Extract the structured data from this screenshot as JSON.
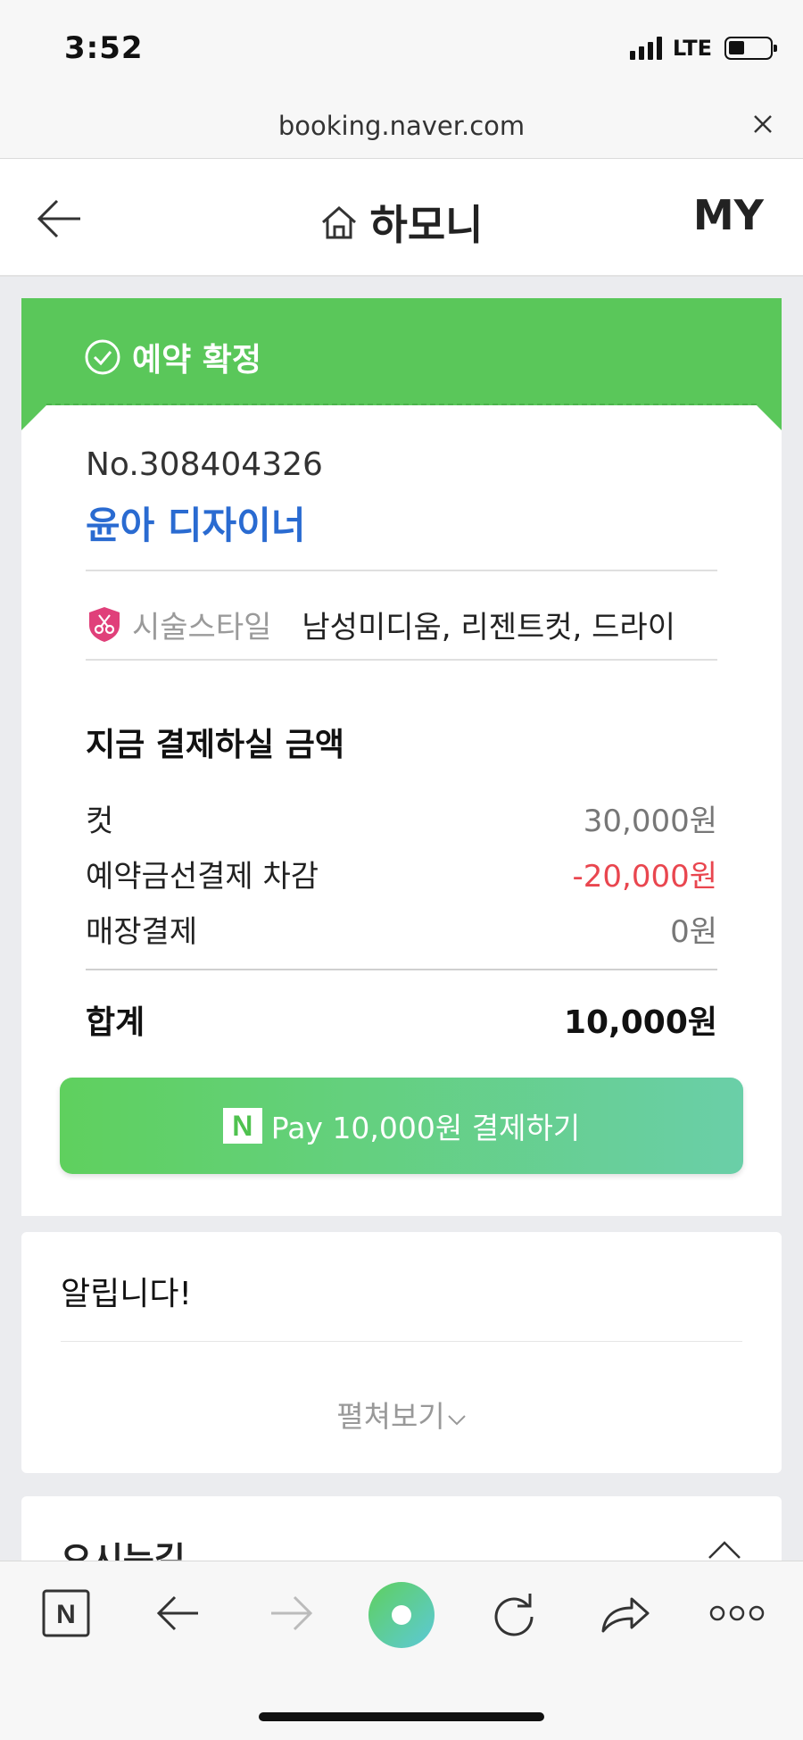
{
  "status_bar": {
    "time": "3:52",
    "network": "LTE"
  },
  "browser": {
    "url": "booking.naver.com"
  },
  "header": {
    "title": "하모니",
    "my_label": "MY"
  },
  "reservation": {
    "status": "예약 확정",
    "number": "No.308404326",
    "designer": "윤아 디자이너",
    "style_label": "시술스타일",
    "style_value": "남성미디움, 리젠트컷, 드라이"
  },
  "payment": {
    "title": "지금 결제하실 금액",
    "items": [
      {
        "label": "컷",
        "value": "30,000원"
      },
      {
        "label": "예약금선결제 차감",
        "value": "-20,000원"
      },
      {
        "label": "매장결제",
        "value": "0원"
      }
    ],
    "total_label": "합계",
    "total_value": "10,000원",
    "button_logo": "N",
    "button_label": "Pay 10,000원 결제하기"
  },
  "notice": {
    "title": "알립니다!",
    "expand_label": "펼쳐보기"
  },
  "directions": {
    "title": "오시는길"
  },
  "toolbar": {
    "items": [
      "naver-home-icon",
      "back-arrow-icon",
      "forward-arrow-icon",
      "green-dot-icon",
      "refresh-icon",
      "share-icon",
      "more-icon"
    ]
  },
  "colors": {
    "accent_green": "#5ac75a",
    "designer_blue": "#2a6bd1",
    "negative_red": "#e9464f"
  }
}
